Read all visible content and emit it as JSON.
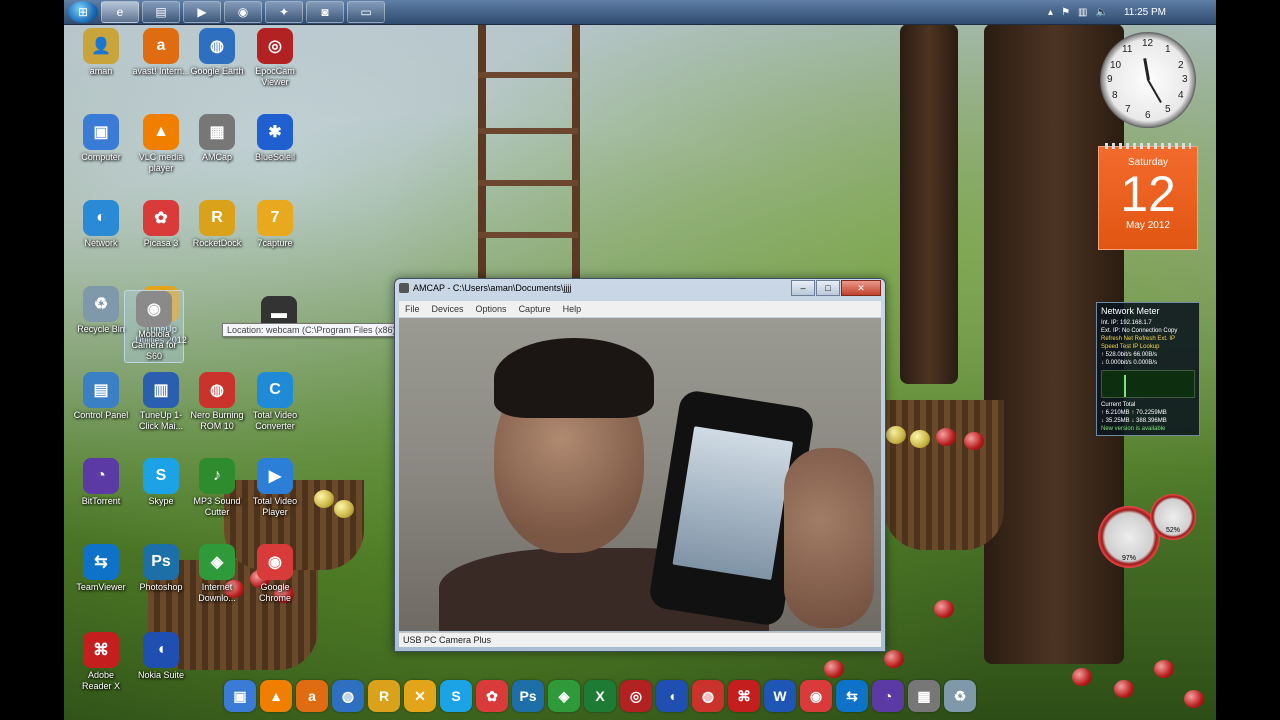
{
  "taskbar": {
    "start_label": "Start",
    "buttons": [
      {
        "name": "internet-explorer",
        "glyph": "e"
      },
      {
        "name": "folder",
        "glyph": "▤"
      },
      {
        "name": "media-player",
        "glyph": "▶"
      },
      {
        "name": "chrome",
        "glyph": "◉"
      },
      {
        "name": "rocketdock",
        "glyph": "✦"
      },
      {
        "name": "amcap",
        "glyph": "◙"
      },
      {
        "name": "window",
        "glyph": "▭"
      }
    ],
    "clock": "11:25 PM"
  },
  "desktop_icons": [
    {
      "id": "aman",
      "label": "aman",
      "glyph": "👤",
      "color": "#c9a43a"
    },
    {
      "id": "avast",
      "label": "avast! Intern...",
      "glyph": "a",
      "color": "#e06c12"
    },
    {
      "id": "google-earth",
      "label": "Google Earth",
      "glyph": "◍",
      "color": "#2e6fbf"
    },
    {
      "id": "epoccam",
      "label": "EpocCam Viewer",
      "glyph": "◎",
      "color": "#b22222"
    },
    {
      "id": "computer",
      "label": "Computer",
      "glyph": "▣",
      "color": "#3a7bd5"
    },
    {
      "id": "vlc",
      "label": "VLC media player",
      "glyph": "▲",
      "color": "#f07f00"
    },
    {
      "id": "amcap",
      "label": "AMCap",
      "glyph": "▦",
      "color": "#777"
    },
    {
      "id": "bluesoleil",
      "label": "BlueSoleil",
      "glyph": "✱",
      "color": "#1f5fcf"
    },
    {
      "id": "network",
      "label": "Network",
      "glyph": "◐",
      "color": "#2b8ad6"
    },
    {
      "id": "picasa",
      "label": "Picasa 3",
      "glyph": "✿",
      "color": "#d93a3a"
    },
    {
      "id": "rocketdock",
      "label": "RocketDock",
      "glyph": "R",
      "color": "#d9a21a"
    },
    {
      "id": "7capture",
      "label": "7capture",
      "glyph": "7",
      "color": "#e9a91f"
    },
    {
      "id": "recycle-bin",
      "label": "Recycle Bin",
      "glyph": "♻",
      "color": "#7f98aa"
    },
    {
      "id": "tuneup",
      "label": "TuneUp Utilities 2012",
      "glyph": "✕",
      "color": "#e2a418"
    },
    {
      "id": "mobiola",
      "label": "Mobiola Camera for S60",
      "glyph": "◉",
      "color": "#8a8a8a"
    },
    {
      "id": "unnamed",
      "label": "",
      "glyph": "▬",
      "color": "#333"
    },
    {
      "id": "control-panel",
      "label": "Control Panel",
      "glyph": "▤",
      "color": "#3b7fc4"
    },
    {
      "id": "tuneup-1click",
      "label": "TuneUp 1-Click Mai...",
      "glyph": "▥",
      "color": "#2a5fb0"
    },
    {
      "id": "nero",
      "label": "Nero Burning ROM 10",
      "glyph": "◍",
      "color": "#c9332b"
    },
    {
      "id": "total-video-converter",
      "label": "Total Video Converter",
      "glyph": "C",
      "color": "#1f8bd6"
    },
    {
      "id": "bittorrent",
      "label": "BitTorrent",
      "glyph": "◔",
      "color": "#5b3aa6"
    },
    {
      "id": "skype",
      "label": "Skype",
      "glyph": "S",
      "color": "#1ba3e6"
    },
    {
      "id": "mp3-cutter",
      "label": "MP3 Sound Cutter",
      "glyph": "♪",
      "color": "#2e8b2e"
    },
    {
      "id": "total-video-player",
      "label": "Total Video Player",
      "glyph": "▶",
      "color": "#2b7fd6"
    },
    {
      "id": "teamviewer",
      "label": "TeamViewer",
      "glyph": "⇆",
      "color": "#0e72c8"
    },
    {
      "id": "photoshop",
      "label": "Photoshop",
      "glyph": "Ps",
      "color": "#1d6fa8"
    },
    {
      "id": "internet-download",
      "label": "Internet Downlo...",
      "glyph": "◈",
      "color": "#2e9a3a"
    },
    {
      "id": "google-chrome",
      "label": "Google Chrome",
      "glyph": "◉",
      "color": "#d93a3a"
    },
    {
      "id": "adobe-reader",
      "label": "Adobe Reader X",
      "glyph": "⌘",
      "color": "#c41e1e"
    },
    {
      "id": "nokia-suite",
      "label": "Nokia Suite",
      "glyph": "◖",
      "color": "#1f4fb0"
    }
  ],
  "tooltip": "Location: webcam (C:\\Program Files (x86)\\Mobiola Web Camera for S60)",
  "amcap": {
    "title": "AMCAP - C:\\Users\\aman\\Documents\\jjjj",
    "menu": [
      "File",
      "Devices",
      "Options",
      "Capture",
      "Help"
    ],
    "status": "USB PC Camera Plus",
    "min": "–",
    "max": "□",
    "close": "✕"
  },
  "gadgets": {
    "clock_numbers": [
      "12",
      "1",
      "2",
      "3",
      "4",
      "5",
      "6",
      "7",
      "8",
      "9",
      "10",
      "11"
    ],
    "calendar": {
      "day": "Saturday",
      "date": "12",
      "month": "May 2012"
    },
    "network_meter": {
      "title": "Network Meter",
      "lines": [
        {
          "text": "Int. IP:  192.168.1.7",
          "cls": ""
        },
        {
          "text": "Ext. IP: No Connection    Copy",
          "cls": ""
        },
        {
          "text": "Refresh Net   Refresh Ext. IP",
          "cls": "y"
        },
        {
          "text": "Speed Test      IP Lookup",
          "cls": "y"
        },
        {
          "text": "↑ 528.0bit/s       66.00B/s",
          "cls": ""
        },
        {
          "text": "↓ 0.000bit/s       0.000B/s",
          "cls": ""
        }
      ],
      "footer": [
        {
          "text": "Current             Total",
          "cls": ""
        },
        {
          "text": "↑ 6.210MB      ↑ 70.2259MB",
          "cls": ""
        },
        {
          "text": "↓ 35.25MB     ↓ 388.396MB",
          "cls": ""
        },
        {
          "text": "New version is available",
          "cls": "g"
        }
      ]
    },
    "gauge_cpu": "97%",
    "gauge_mem": "52%"
  },
  "dock": [
    {
      "id": "computer",
      "glyph": "▣",
      "color": "#3a7bd5"
    },
    {
      "id": "vlc",
      "glyph": "▲",
      "color": "#f07f00"
    },
    {
      "id": "avast",
      "glyph": "a",
      "color": "#e06c12"
    },
    {
      "id": "google-earth",
      "glyph": "◍",
      "color": "#2e6fbf"
    },
    {
      "id": "rocketdock",
      "glyph": "R",
      "color": "#d9a21a"
    },
    {
      "id": "tuneup",
      "glyph": "✕",
      "color": "#e2a418"
    },
    {
      "id": "skype",
      "glyph": "S",
      "color": "#1ba3e6"
    },
    {
      "id": "picasa",
      "glyph": "✿",
      "color": "#d93a3a"
    },
    {
      "id": "photoshop",
      "glyph": "Ps",
      "color": "#1d6fa8"
    },
    {
      "id": "internet-download",
      "glyph": "◈",
      "color": "#2e9a3a"
    },
    {
      "id": "excel",
      "glyph": "X",
      "color": "#1e7b34"
    },
    {
      "id": "epoccam",
      "glyph": "◎",
      "color": "#b22222"
    },
    {
      "id": "nokia-suite",
      "glyph": "◖",
      "color": "#1f4fb0"
    },
    {
      "id": "nero",
      "glyph": "◍",
      "color": "#c9332b"
    },
    {
      "id": "adobe-reader",
      "glyph": "⌘",
      "color": "#c41e1e"
    },
    {
      "id": "word",
      "glyph": "W",
      "color": "#1f56b5"
    },
    {
      "id": "google-chrome",
      "glyph": "◉",
      "color": "#d93a3a"
    },
    {
      "id": "teamviewer",
      "glyph": "⇆",
      "color": "#0e72c8"
    },
    {
      "id": "bittorrent",
      "glyph": "◔",
      "color": "#5b3aa6"
    },
    {
      "id": "amcap",
      "glyph": "▦",
      "color": "#777"
    },
    {
      "id": "recycle-bin",
      "glyph": "♻",
      "color": "#7f98aa"
    }
  ]
}
